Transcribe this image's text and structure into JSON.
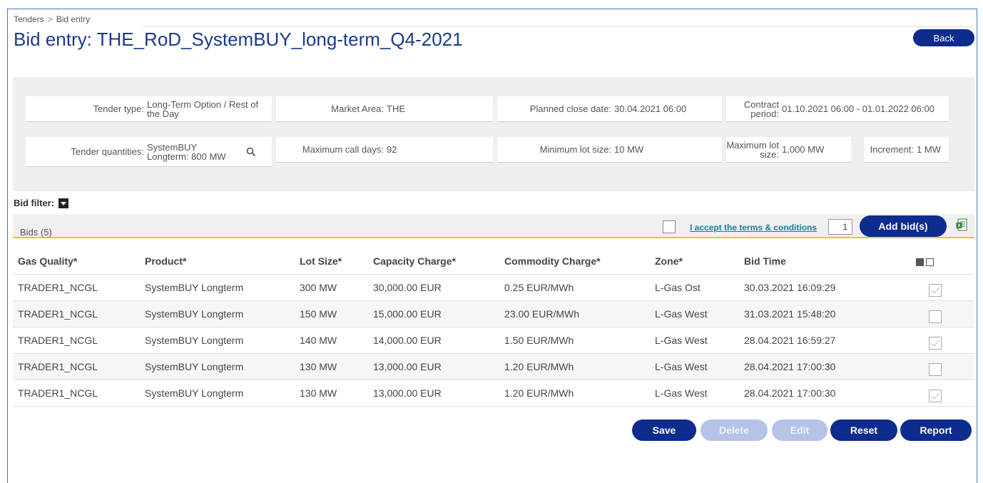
{
  "breadcrumb": {
    "items": [
      "Tenders",
      "Bid entry"
    ],
    "separator": ">"
  },
  "page": {
    "title": "Bid entry: THE_RoD_SystemBUY_long-term_Q4-2021",
    "back_label": "Back"
  },
  "info": {
    "tender_type": {
      "label": "Tender type:",
      "value": "Long-Term Option / Rest of the Day"
    },
    "market_area": {
      "label": "Market Area:",
      "value": "THE"
    },
    "planned_close": {
      "label": "Planned close date:",
      "value": "30.04.2021 06:00"
    },
    "contract_period": {
      "label": "Contract period:",
      "value": "01.10.2021 06:00 - 01.01.2022 06:00"
    },
    "tender_quantities": {
      "label": "Tender quantities:",
      "value": "SystemBUY Longterm: 800 MW"
    },
    "max_call_days": {
      "label": "Maximum call days:",
      "value": "92"
    },
    "min_lot": {
      "label": "Minimum lot size:",
      "value": "10 MW"
    },
    "max_lot": {
      "label": "Maximum lot size:",
      "value": "1,000 MW"
    },
    "increment": {
      "label": "Increment:",
      "value": "1 MW"
    }
  },
  "filter": {
    "label": "Bid filter:"
  },
  "bids_bar": {
    "count_label": "Bids (5)",
    "terms_label": "I accept the terms & conditions",
    "quantity_value": "1",
    "add_label": "Add bid(s)"
  },
  "table": {
    "headers": [
      "Gas Quality*",
      "Product*",
      "Lot Size*",
      "Capacity Charge*",
      "Commodity Charge*",
      "Zone*",
      "Bid Time"
    ],
    "rows": [
      [
        "TRADER1_NCGL",
        "SystemBUY Longterm",
        "300 MW",
        "30,000.00 EUR",
        "0.25 EUR/MWh",
        "L-Gas Ost",
        "30.03.2021 16:09:29"
      ],
      [
        "TRADER1_NCGL",
        "SystemBUY Longterm",
        "150 MW",
        "15,000.00 EUR",
        "23.00 EUR/MWh",
        "L-Gas West",
        "31.03.2021 15:48:20"
      ],
      [
        "TRADER1_NCGL",
        "SystemBUY Longterm",
        "140 MW",
        "14,000.00 EUR",
        "1.50 EUR/MWh",
        "L-Gas West",
        "28.04.2021 16:59:27"
      ],
      [
        "TRADER1_NCGL",
        "SystemBUY Longterm",
        "130 MW",
        "13,000.00 EUR",
        "1.20 EUR/MWh",
        "L-Gas West",
        "28.04.2021 17:00:30"
      ],
      [
        "TRADER1_NCGL",
        "SystemBUY Longterm",
        "130 MW",
        "13,000.00 EUR",
        "1.20 EUR/MWh",
        "L-Gas West",
        "28.04.2021 17:00:30"
      ]
    ],
    "row_checked": [
      true,
      false,
      true,
      false,
      true
    ]
  },
  "actions": {
    "save": "Save",
    "delete": "Delete",
    "edit": "Edit",
    "reset": "Reset",
    "report": "Report"
  },
  "colors": {
    "primary": "#0e2b8e",
    "disabled": "#b4c3e6",
    "accent_rule": "#f3c12e",
    "link": "#1a7a9e",
    "title": "#1b3a8c"
  },
  "icons": {
    "quantities": "search-icon",
    "export": "excel-export-icon",
    "filter": "filter-toggle-icon"
  }
}
